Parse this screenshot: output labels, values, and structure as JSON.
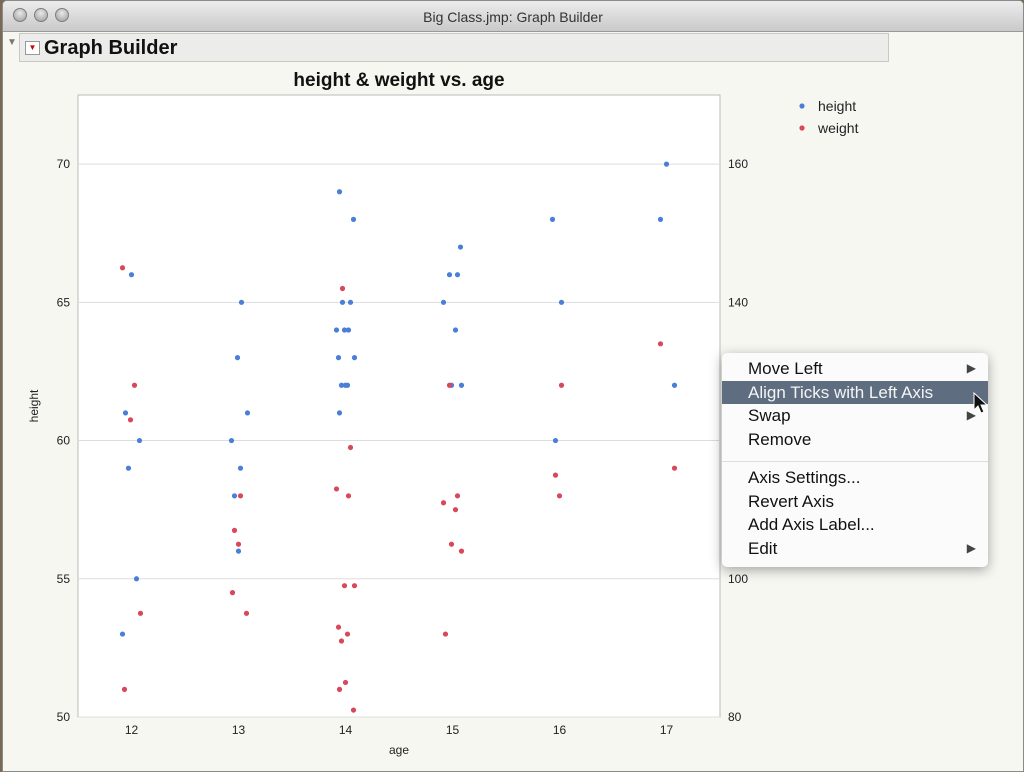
{
  "window": {
    "title": "Big Class.jmp: Graph Builder"
  },
  "panel": {
    "title": "Graph Builder"
  },
  "colors": {
    "height": "#4a7fd8",
    "weight": "#d8485a",
    "menu_highlight": "#5e6e80"
  },
  "chart_data": {
    "type": "scatter",
    "title": "height & weight vs. age",
    "xlabel": "age",
    "ylabel": "height",
    "x_ticks": [
      "12",
      "13",
      "14",
      "15",
      "16",
      "17"
    ],
    "xlim": [
      11.5,
      17.5
    ],
    "y_left": {
      "ticks": [
        "50",
        "55",
        "60",
        "65",
        "70"
      ],
      "lim": [
        50,
        72.5
      ]
    },
    "y_right": {
      "ticks": [
        "80",
        "100",
        "120",
        "140",
        "160"
      ],
      "lim": [
        80,
        170
      ]
    },
    "grid": true,
    "legend": {
      "placement": "top-right",
      "entries": [
        "height",
        "weight"
      ]
    },
    "series": [
      {
        "name": "height",
        "axis": "left",
        "points": [
          [
            12,
            66
          ],
          [
            12,
            61
          ],
          [
            12,
            60
          ],
          [
            12,
            59
          ],
          [
            12,
            55
          ],
          [
            12,
            53
          ],
          [
            13,
            65
          ],
          [
            13,
            63
          ],
          [
            13,
            61
          ],
          [
            13,
            60
          ],
          [
            13,
            59
          ],
          [
            13,
            58
          ],
          [
            13,
            56
          ],
          [
            14,
            69
          ],
          [
            14,
            68
          ],
          [
            14,
            65
          ],
          [
            14,
            65
          ],
          [
            14,
            64
          ],
          [
            14,
            64
          ],
          [
            14,
            64
          ],
          [
            14,
            63
          ],
          [
            14,
            63
          ],
          [
            14,
            62
          ],
          [
            14,
            62
          ],
          [
            14,
            62
          ],
          [
            14,
            61
          ],
          [
            15,
            67
          ],
          [
            15,
            66
          ],
          [
            15,
            66
          ],
          [
            15,
            65
          ],
          [
            15,
            64
          ],
          [
            15,
            62
          ],
          [
            15,
            62
          ],
          [
            16,
            68
          ],
          [
            16,
            65
          ],
          [
            16,
            60
          ],
          [
            17,
            70
          ],
          [
            17,
            68
          ],
          [
            17,
            62
          ]
        ]
      },
      {
        "name": "weight",
        "axis": "right",
        "points": [
          [
            12,
            145
          ],
          [
            12,
            128
          ],
          [
            12,
            123
          ],
          [
            12,
            95
          ],
          [
            12,
            84
          ],
          [
            13,
            112
          ],
          [
            13,
            107
          ],
          [
            13,
            105
          ],
          [
            13,
            98
          ],
          [
            13,
            95
          ],
          [
            14,
            142
          ],
          [
            14,
            119
          ],
          [
            14,
            113
          ],
          [
            14,
            112
          ],
          [
            14,
            99
          ],
          [
            14,
            99
          ],
          [
            14,
            93
          ],
          [
            14,
            92
          ],
          [
            14,
            91
          ],
          [
            14,
            85
          ],
          [
            14,
            84
          ],
          [
            14,
            81
          ],
          [
            15,
            128
          ],
          [
            15,
            112
          ],
          [
            15,
            111
          ],
          [
            15,
            110
          ],
          [
            15,
            105
          ],
          [
            15,
            104
          ],
          [
            15,
            92
          ],
          [
            16,
            128
          ],
          [
            16,
            115
          ],
          [
            16,
            112
          ],
          [
            17,
            134
          ],
          [
            17,
            116
          ]
        ]
      }
    ]
  },
  "context_menu": {
    "items": [
      {
        "label": "Move Left",
        "submenu": true
      },
      {
        "label": "Align Ticks with Left Axis",
        "submenu": false,
        "selected": true
      },
      {
        "label": "Swap",
        "submenu": true
      },
      {
        "label": "Remove",
        "submenu": false
      },
      {
        "label": "Axis Settings...",
        "submenu": false
      },
      {
        "label": "Revert Axis",
        "submenu": false
      },
      {
        "label": "Add Axis Label...",
        "submenu": false
      },
      {
        "label": "Edit",
        "submenu": true
      }
    ],
    "arrow_glyph": "▶"
  }
}
